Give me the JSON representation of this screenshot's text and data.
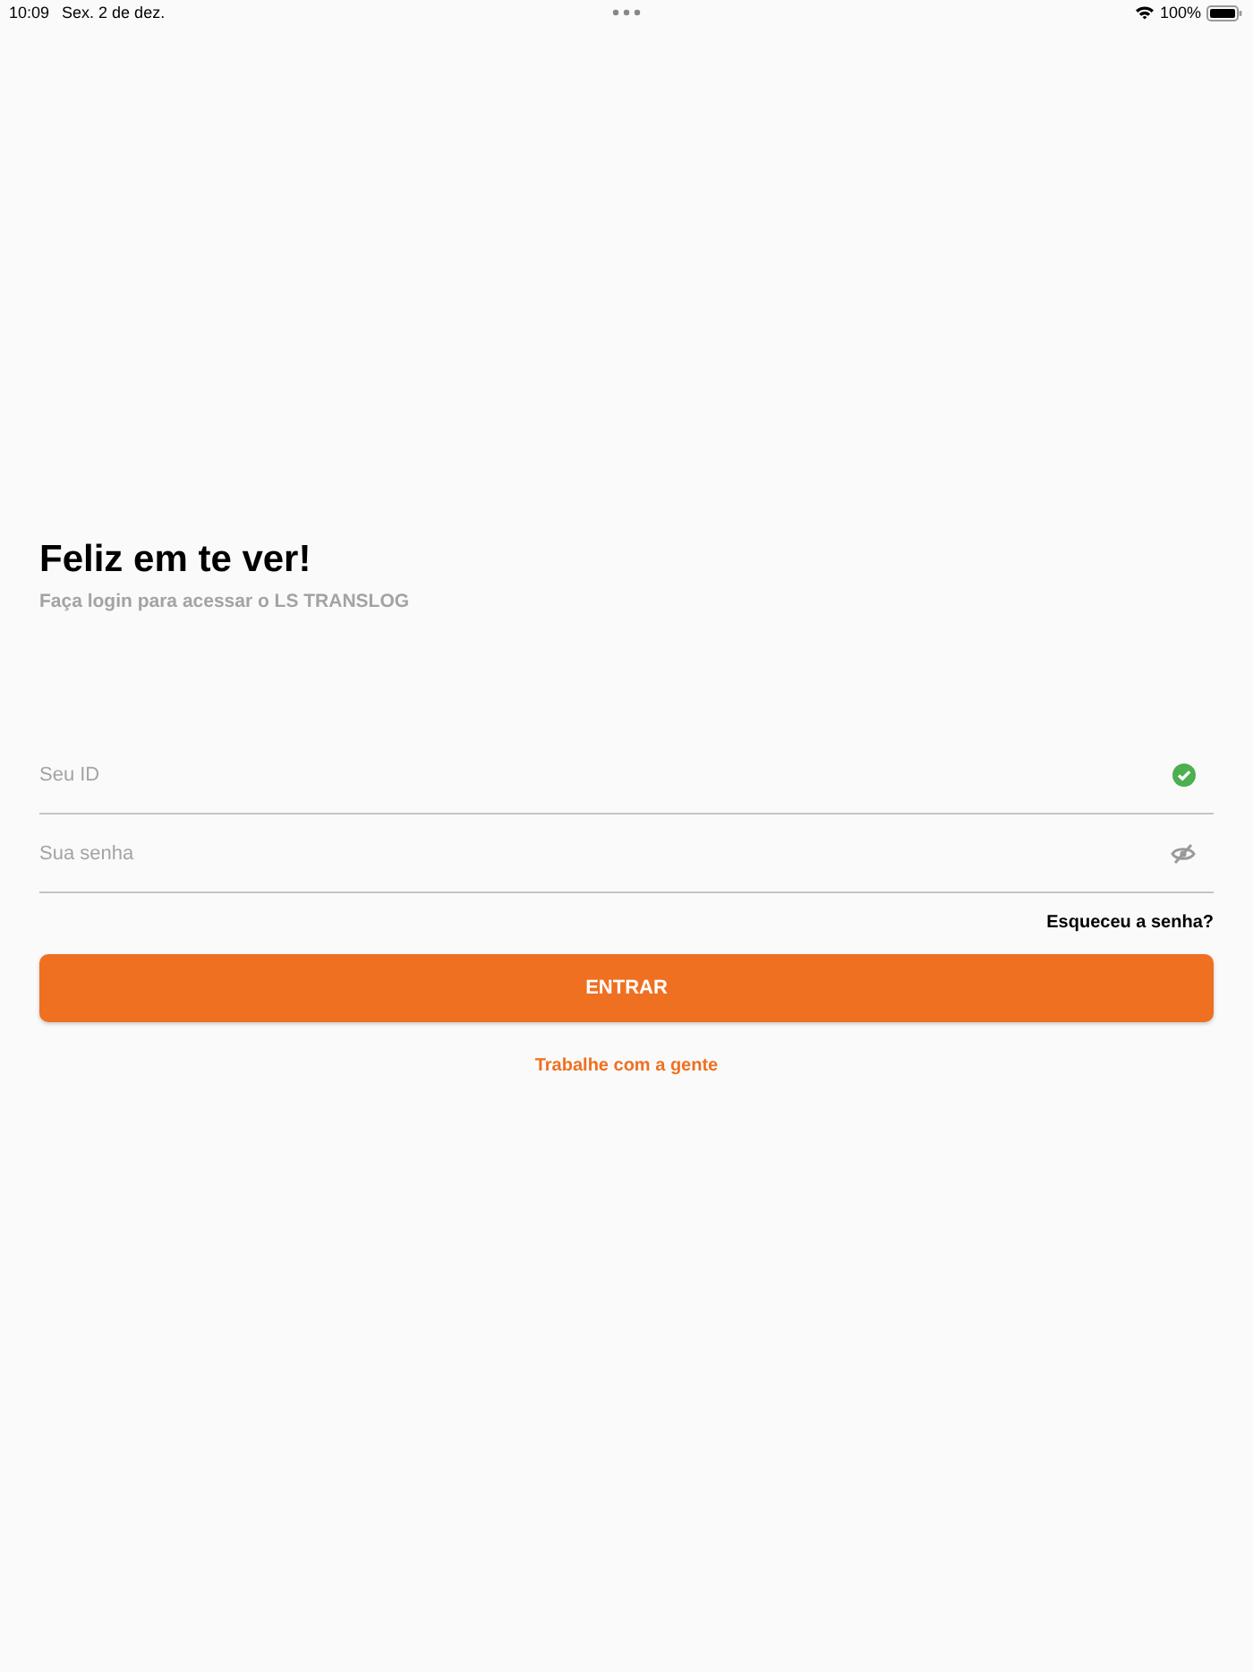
{
  "status_bar": {
    "time": "10:09",
    "date": "Sex. 2 de dez.",
    "battery": "100%"
  },
  "heading": "Feliz em te ver!",
  "subtitle": "Faça login para acessar o LS TRANSLOG",
  "fields": [
    {
      "placeholder": "Seu ID",
      "kind": "valid"
    },
    {
      "placeholder": "Sua senha",
      "kind": "password"
    }
  ],
  "forgot_link": "Esqueceu a senha?",
  "submit_button": "ENTRAR",
  "join_link": "Trabalhe com a gente"
}
